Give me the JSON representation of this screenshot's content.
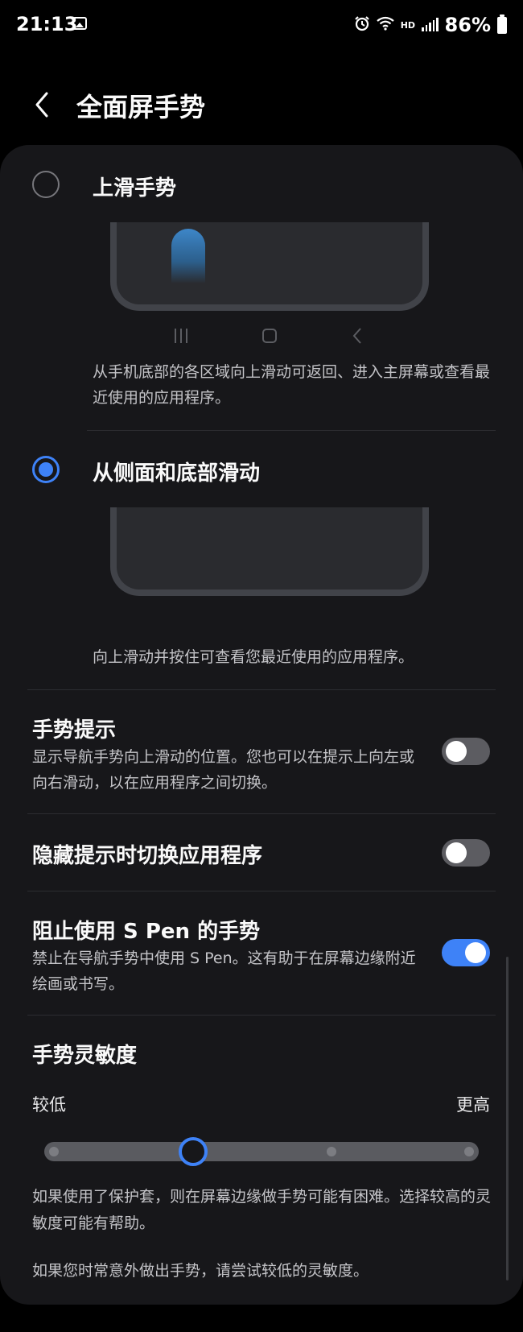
{
  "status_bar": {
    "time": "21:13",
    "hd": "HD",
    "battery": "86%"
  },
  "header": {
    "title": "全面屏手势"
  },
  "options": [
    {
      "label": "上滑手势",
      "selected": false,
      "description": "从手机底部的各区域向上滑动可返回、进入主屏幕或查看最近使用的应用程序。"
    },
    {
      "label": "从侧面和底部滑动",
      "selected": true,
      "description": "向上滑动并按住可查看您最近使用的应用程序。"
    }
  ],
  "settings": {
    "gesture_hint": {
      "title": "手势提示",
      "subtitle": "显示导航手势向上滑动的位置。您也可以在提示上向左或向右滑动，以在应用程序之间切换。",
      "enabled": false
    },
    "switch_apps_hidden": {
      "title": "隐藏提示时切换应用程序",
      "enabled": false
    },
    "block_spen": {
      "title": "阻止使用 S Pen 的手势",
      "subtitle": "禁止在导航手势中使用 S Pen。这有助于在屏幕边缘附近绘画或书写。",
      "enabled": true
    }
  },
  "sensitivity": {
    "title": "手势灵敏度",
    "low_label": "较低",
    "high_label": "更高",
    "levels": 5,
    "current_level": 2,
    "note1": "如果使用了保护套，则在屏幕边缘做手势可能有困难。选择较高的灵敏度可能有帮助。",
    "note2": "如果您时常意外做出手势，请尝试较低的灵敏度。"
  },
  "colors": {
    "accent": "#3e82f7",
    "card_bg": "#17171a",
    "background": "#000000"
  }
}
